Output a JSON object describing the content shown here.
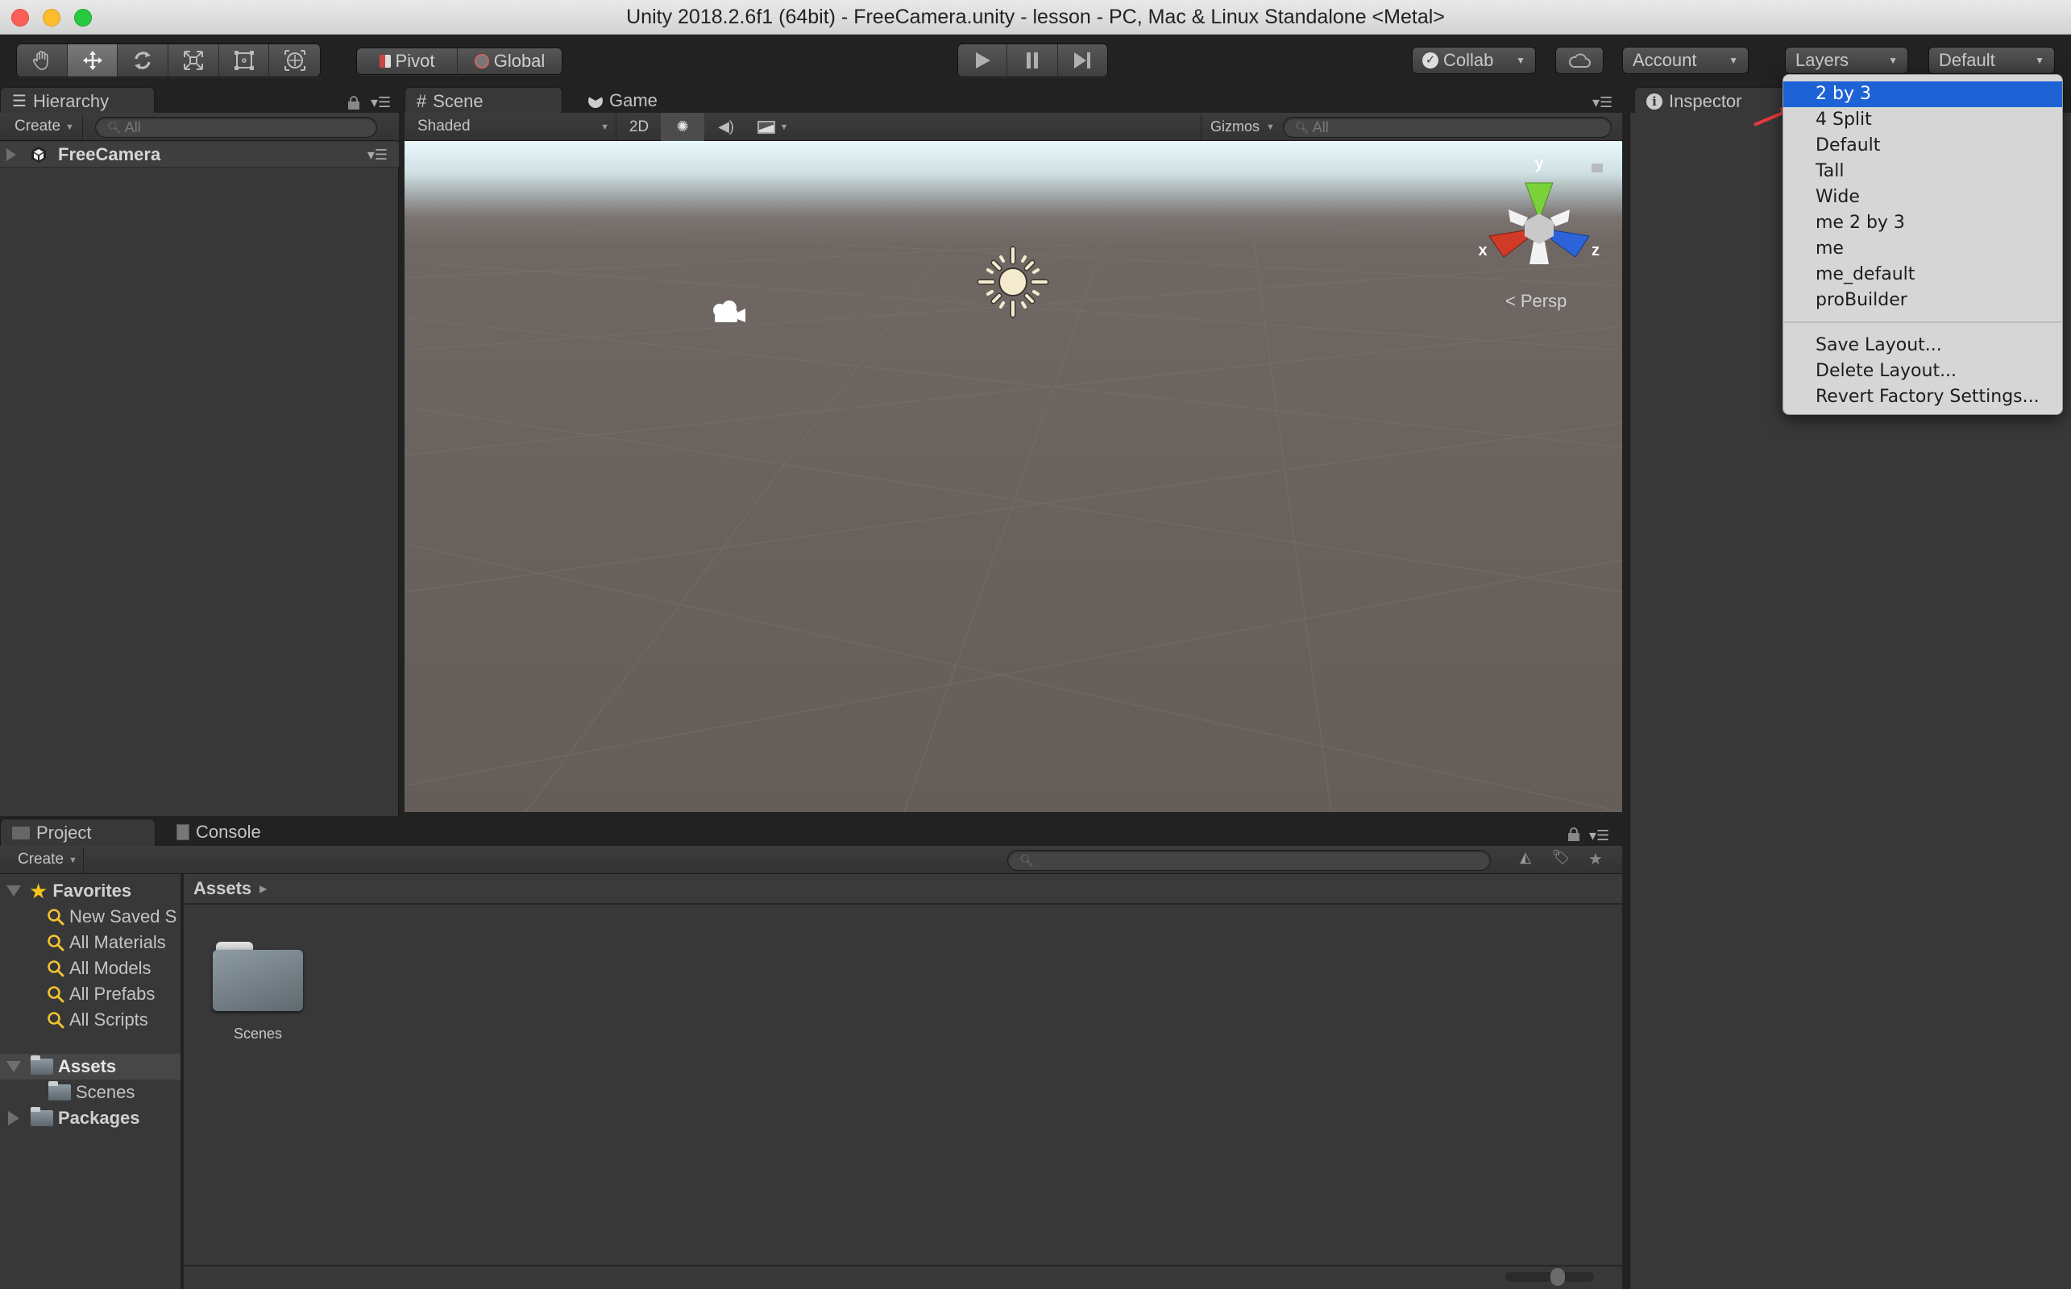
{
  "window": {
    "title": "Unity 2018.2.6f1 (64bit) - FreeCamera.unity - lesson - PC, Mac & Linux Standalone <Metal>",
    "traffic_lights": {
      "close": "#fc5f57",
      "minimize": "#fdbc2e",
      "zoom": "#28c840"
    }
  },
  "toolbar": {
    "transform_tools": [
      {
        "icon": "hand-icon",
        "active": false
      },
      {
        "icon": "move-icon",
        "active": true
      },
      {
        "icon": "rotate-icon",
        "active": false
      },
      {
        "icon": "scale-icon",
        "active": false
      },
      {
        "icon": "rect-tool-icon",
        "active": false
      },
      {
        "icon": "transform-tool-icon",
        "active": false
      }
    ],
    "pivot_label": "Pivot",
    "global_label": "Global",
    "play_controls": [
      "play-icon",
      "pause-icon",
      "step-icon"
    ],
    "collab_label": "Collab",
    "account_label": "Account",
    "layers_label": "Layers",
    "layout_label": "Default"
  },
  "hierarchy": {
    "tab_label": "Hierarchy",
    "create_label": "Create",
    "search_placeholder": "All",
    "items": [
      {
        "label": "FreeCamera",
        "icon": "unity-logo-icon"
      }
    ]
  },
  "scene": {
    "tabs": [
      {
        "label": "Scene",
        "icon": "grid-icon",
        "active": true
      },
      {
        "label": "Game",
        "icon": "pacman-icon",
        "active": false
      }
    ],
    "draw_mode": "Shaded",
    "mode_2d_label": "2D",
    "gizmos_label": "Gizmos",
    "search_placeholder": "All",
    "gizmo": {
      "x_label": "x",
      "y_label": "y",
      "z_label": "z",
      "projection": "Persp",
      "colors": {
        "x": "#d03a26",
        "y": "#7bd13a",
        "z": "#2c63d8"
      }
    }
  },
  "inspector": {
    "tab_label": "Inspector"
  },
  "project": {
    "tabs": [
      {
        "label": "Project",
        "active": true
      },
      {
        "label": "Console",
        "active": false
      }
    ],
    "create_label": "Create",
    "favorites_label": "Favorites",
    "favorites": [
      "New Saved S",
      "All Materials",
      "All Models",
      "All Prefabs",
      "All Scripts"
    ],
    "tree": [
      {
        "label": "Assets",
        "expanded": true,
        "selected": true,
        "children": [
          "Scenes"
        ]
      },
      {
        "label": "Packages",
        "expanded": false
      }
    ],
    "breadcrumb": "Assets",
    "assets": [
      {
        "label": "Scenes",
        "type": "folder"
      }
    ]
  },
  "layout_menu": {
    "items": [
      "2 by 3",
      "4 Split",
      "Default",
      "Tall",
      "Wide",
      "me 2 by 3",
      "me",
      "me_default",
      "proBuilder"
    ],
    "selected": "2 by 3",
    "actions": [
      "Save Layout...",
      "Delete Layout...",
      "Revert Factory Settings..."
    ],
    "highlight_color": "#1e63d6"
  }
}
